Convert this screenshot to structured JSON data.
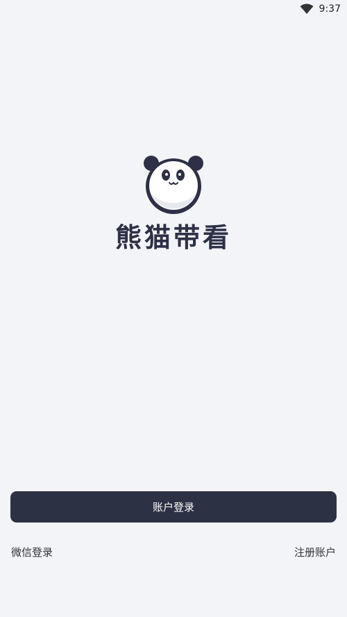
{
  "status_bar": {
    "time": "9:37",
    "wifi_icon": "wifi-icon"
  },
  "brand": {
    "logo_icon": "panda-icon",
    "app_name": "熊猫带看",
    "color": "#2d3047"
  },
  "actions": {
    "account_login_label": "账户登录",
    "wechat_login_label": "微信登录",
    "register_label": "注册账户",
    "button_color": "#2d3144"
  }
}
